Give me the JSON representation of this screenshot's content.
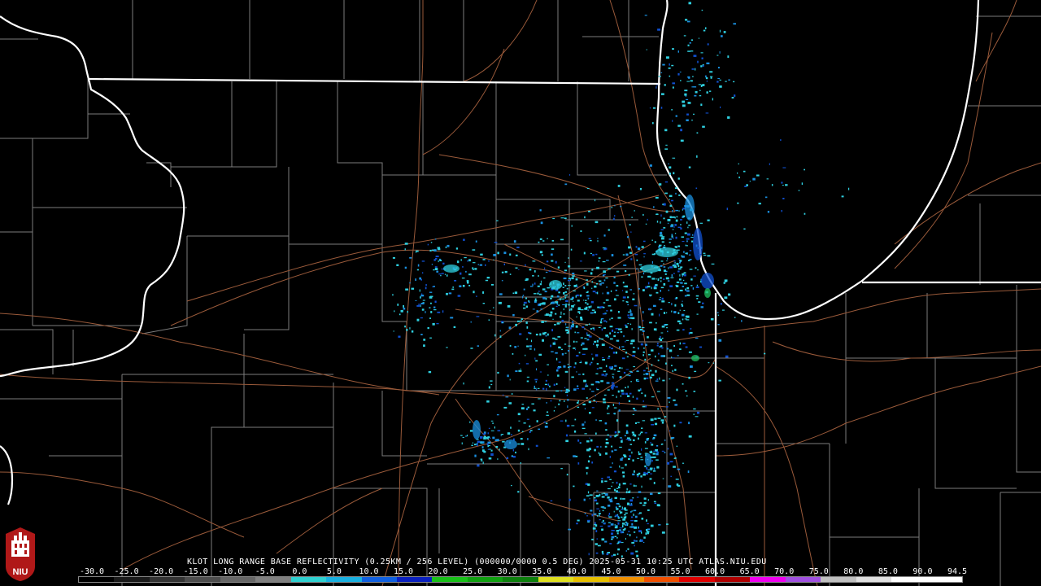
{
  "caption": "KLOT LONG RANGE BASE REFLECTIVITY (0.25KM / 256 LEVEL) (000000/0000 0.5 DEG) 2025-05-31 10:25 UTC  ATLAS.NIU.EDU",
  "scale": {
    "ticks": [
      "-30.0",
      "-25.0",
      "-20.0",
      "-15.0",
      "-10.0",
      "-5.0",
      "0.0",
      "5.0",
      "10.0",
      "15.0",
      "20.0",
      "25.0",
      "30.0",
      "35.0",
      "40.0",
      "45.0",
      "50.0",
      "55.0",
      "60.0",
      "65.0",
      "70.0",
      "75.0",
      "80.0",
      "85.0",
      "90.0",
      "94.5"
    ],
    "colors": [
      "#000000",
      "#1a1a1a",
      "#333333",
      "#4d4d4d",
      "#666666",
      "#808080",
      "#2fd0d0",
      "#19b0e0",
      "#1060e0",
      "#0a20c0",
      "#18c018",
      "#10a010",
      "#0d800d",
      "#e0e020",
      "#e8c000",
      "#f09000",
      "#f05000",
      "#e00000",
      "#b00000",
      "#f000f0",
      "#a050e0",
      "#c0c0c0",
      "#e0e0e0",
      "#ffffff",
      "#ffffff"
    ]
  },
  "logo_text": "NIU",
  "colors": {
    "state_border": "#ffffff",
    "county_border": "#8c8c8c",
    "highway": "#9a5a3a",
    "echo_light": "#2fd0e0",
    "echo_mid": "#1a90e0",
    "echo_strong": "#1050d0",
    "echo_green": "#20c060"
  }
}
